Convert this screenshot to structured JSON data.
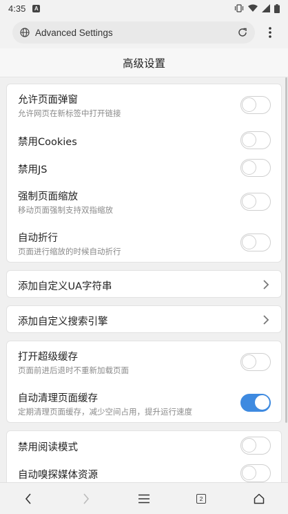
{
  "status_bar": {
    "time": "4:35",
    "notification_icon": "A"
  },
  "browser": {
    "address_text": "Advanced Settings",
    "icons": [
      "globe-icon",
      "reload-icon",
      "more-vert-icon"
    ]
  },
  "page": {
    "title": "高级设置"
  },
  "cards": {
    "general": {
      "items": [
        {
          "title": "允许页面弹窗",
          "subtitle": "允许网页在新标签中打开链接",
          "enabled": false
        },
        {
          "title": "禁用Cookies",
          "enabled": false
        },
        {
          "title": "禁用JS",
          "enabled": false
        },
        {
          "title": "强制页面缩放",
          "subtitle": "移动页面强制支持双指缩放",
          "enabled": false
        },
        {
          "title": "自动折行",
          "subtitle": "页面进行缩放的时候自动折行",
          "enabled": false
        }
      ]
    },
    "ua": {
      "title": "添加自定义UA字符串"
    },
    "search": {
      "title": "添加自定义搜索引擎"
    },
    "cache": {
      "items": [
        {
          "title": "打开超级缓存",
          "subtitle": "页面前进后退时不重新加载页面",
          "enabled": false
        },
        {
          "title": "自动清理页面缓存",
          "subtitle": "定期清理页面缓存，减少空间占用，提升运行速度",
          "enabled": true
        }
      ]
    },
    "media": {
      "items": [
        {
          "title": "禁用阅读模式",
          "enabled": false
        },
        {
          "title": "自动嗅探媒体资源",
          "enabled": false
        }
      ]
    }
  },
  "bottom_nav": {
    "tab_count": "2",
    "icons": [
      "back-icon",
      "forward-icon",
      "menu-icon",
      "tabs-icon",
      "home-icon"
    ]
  },
  "colors": {
    "toggle_on": "#3e8ae0",
    "background": "#f0f0f0",
    "card": "#ffffff"
  }
}
